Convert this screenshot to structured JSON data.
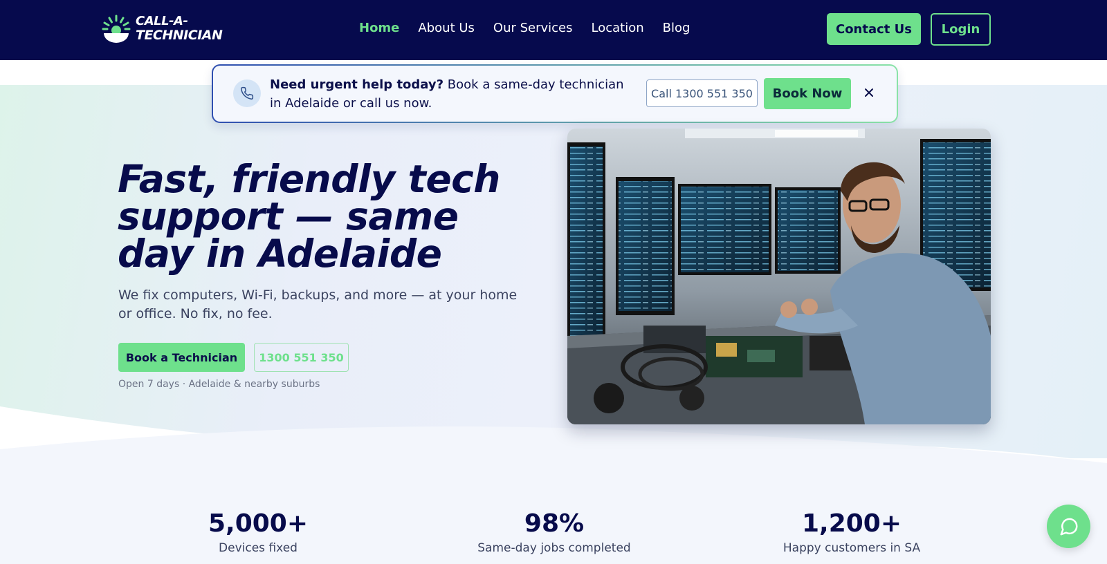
{
  "brand": {
    "line1": "CALL-A-",
    "line2": "TECHNICIAN"
  },
  "nav": {
    "links": [
      "Home",
      "About Us",
      "Our Services",
      "Location",
      "Blog"
    ],
    "active": "Home",
    "contact_label": "Contact Us",
    "login_label": "Login"
  },
  "banner": {
    "bold": "Need urgent help today?",
    "text": " Book a same-day technician in Adelaide or call us now.",
    "call_label": "Call 1300 551 350",
    "book_label": "Book Now",
    "icon": "phone-icon",
    "close_icon": "close-icon"
  },
  "hero": {
    "title": "Fast, friendly tech support — same day in Adelaide",
    "subtitle": "We fix computers, Wi-Fi, backups, and more — at your home or office. No fix, no fee.",
    "primary_cta": "Book a Technician",
    "secondary_cta": "1300 551 350",
    "note": "Open 7 days · Adelaide & nearby suburbs"
  },
  "stats": [
    {
      "value": "5,000+",
      "label": "Devices fixed"
    },
    {
      "value": "98%",
      "label": "Same-day jobs completed"
    },
    {
      "value": "1,200+",
      "label": "Happy customers in SA"
    }
  ],
  "chat": {
    "icon": "chat-bubble-icon"
  },
  "colors": {
    "navy": "#060a4d",
    "accent": "#6ee08c"
  }
}
